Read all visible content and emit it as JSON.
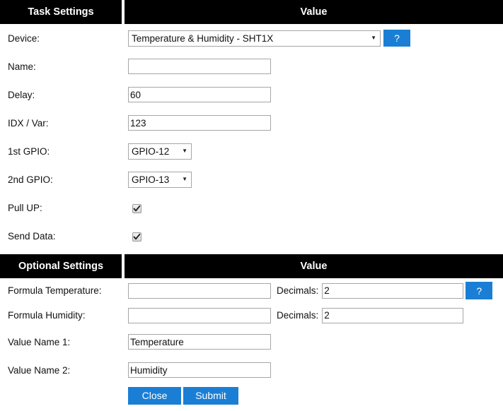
{
  "sections": {
    "task": {
      "header_left": "Task Settings",
      "header_right": "Value"
    },
    "optional": {
      "header_left": "Optional Settings",
      "header_right": "Value"
    }
  },
  "task_fields": {
    "device": {
      "label": "Device:",
      "value": "Temperature & Humidity - SHT1X",
      "help": "?"
    },
    "name": {
      "label": "Name:",
      "value": "",
      "placeholder": ""
    },
    "delay": {
      "label": "Delay:",
      "value": "60"
    },
    "idx_var": {
      "label": "IDX / Var:",
      "value": "123"
    },
    "gpio1": {
      "label": "1st GPIO:",
      "value": "GPIO-12"
    },
    "gpio2": {
      "label": "2nd GPIO:",
      "value": "GPIO-13"
    },
    "pull_up": {
      "label": "Pull UP:",
      "checked": true
    },
    "send_data": {
      "label": "Send Data:",
      "checked": true
    }
  },
  "optional_fields": {
    "formula_temperature": {
      "label": "Formula Temperature:",
      "value": "",
      "decimals_label": "Decimals:",
      "decimals_value": "2",
      "help": "?"
    },
    "formula_humidity": {
      "label": "Formula Humidity:",
      "value": "",
      "decimals_label": "Decimals:",
      "decimals_value": "2"
    },
    "value_name_1": {
      "label": "Value Name 1:",
      "value": "Temperature"
    },
    "value_name_2": {
      "label": "Value Name 2:",
      "value": "Humidity"
    }
  },
  "actions": {
    "close_label": "Close",
    "submit_label": "Submit"
  },
  "icons": {
    "caret_down": "▼"
  },
  "colors": {
    "header_bg": "#000000",
    "header_fg": "#ffffff",
    "accent_blue": "#1a7fd4",
    "field_border": "#a6a6a6",
    "page_bg": "#ffffff",
    "text": "#111111"
  }
}
